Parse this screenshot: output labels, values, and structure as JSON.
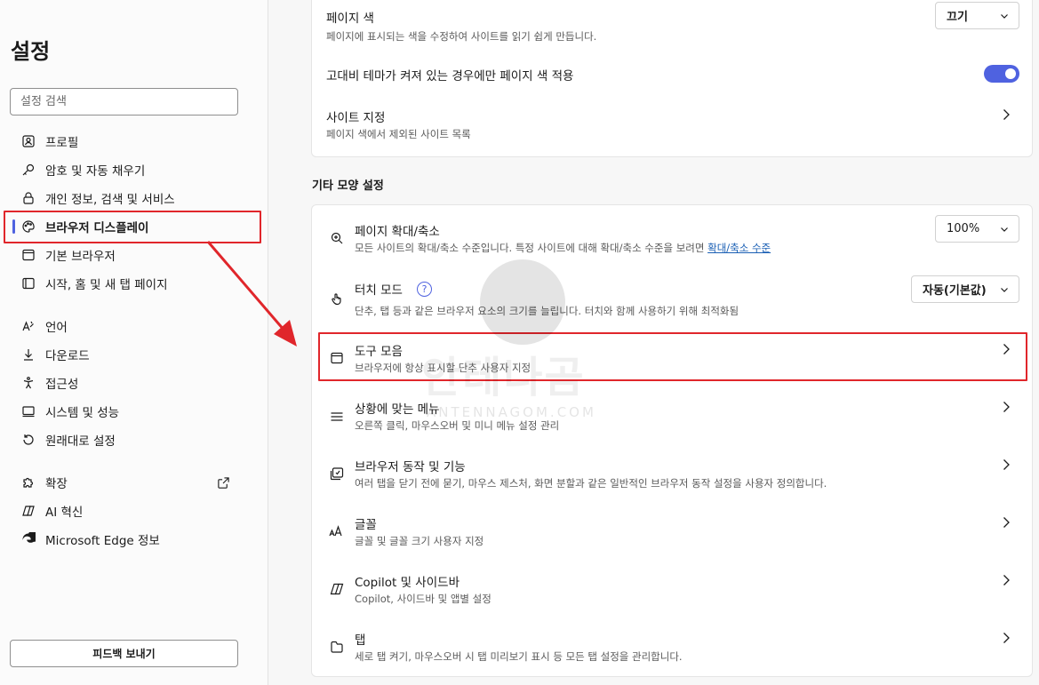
{
  "sidebar": {
    "title": "설정",
    "search_placeholder": "설정 검색",
    "items": [
      {
        "label": "프로필",
        "icon": "profile-icon"
      },
      {
        "label": "암호 및 자동 채우기",
        "icon": "key-icon"
      },
      {
        "label": "개인 정보, 검색 및 서비스",
        "icon": "lock-icon"
      },
      {
        "label": "브라우저 디스플레이",
        "icon": "palette-icon",
        "active": true
      },
      {
        "label": "기본 브라우저",
        "icon": "browser-icon"
      },
      {
        "label": "시작, 홈 및 새 탭 페이지",
        "icon": "home-icon"
      },
      {
        "label": "언어",
        "icon": "language-icon"
      },
      {
        "label": "다운로드",
        "icon": "download-icon"
      },
      {
        "label": "접근성",
        "icon": "accessibility-icon"
      },
      {
        "label": "시스템 및 성능",
        "icon": "system-icon"
      },
      {
        "label": "원래대로 설정",
        "icon": "reset-icon"
      },
      {
        "label": "확장",
        "icon": "extension-icon"
      },
      {
        "label": "AI 혁신",
        "icon": "ai-icon"
      },
      {
        "label": "Microsoft Edge 정보",
        "icon": "edge-icon"
      }
    ],
    "feedback_label": "피드백 보내기"
  },
  "top_card": {
    "page_color": {
      "title": "페이지 색",
      "desc": "페이지에 표시되는 색을 수정하여 사이트를 읽기 쉽게 만듭니다.",
      "value": "끄기"
    },
    "high_contrast": {
      "title": "고대비 테마가 켜져 있는 경우에만 페이지 색 적용",
      "enabled": true
    },
    "site_exclusions": {
      "title": "사이트 지정",
      "desc": "페이지 색에서 제외된 사이트 목록"
    }
  },
  "section_title": "기타 모양 설정",
  "other_card": {
    "zoom": {
      "title": "페이지 확대/축소",
      "desc": "모든 사이트의 확대/축소 수준입니다. 특정 사이트에 대해 확대/축소 수준을 보려면 ",
      "link": "확대/축소 수준",
      "value": "100%"
    },
    "touch": {
      "title": "터치 모드",
      "desc": "단추, 탭 등과 같은 브라우저 요소의 크기를 늘립니다. 터치와 함께 사용하기 위해 최적화됨",
      "value": "자동(기본값)",
      "help": "?"
    },
    "toolbar": {
      "title": "도구 모음",
      "desc": "브라우저에 항상 표시할 단추 사용자 지정"
    },
    "context_menu": {
      "title": "상황에 맞는 메뉴",
      "desc": "오른쪽 클릭, 마우스오버 및 미니 메뉴 설정 관리"
    },
    "behavior": {
      "title": "브라우저 동작 및 기능",
      "desc": "여러 탭을 닫기 전에 묻기, 마우스 제스처, 화면 분할과 같은 일반적인 브라우저 동작 설정을 사용자 정의합니다."
    },
    "fonts": {
      "title": "글꼴",
      "desc": "글꼴 및 글꼴 크기 사용자 지정"
    },
    "copilot": {
      "title": "Copilot 및 사이드바",
      "desc": "Copilot, 사이드바 및 앱별 설정"
    },
    "tabs": {
      "title": "탭",
      "desc": "세로 탭 켜기, 마우스오버 시 탭 미리보기 표시 등 모든 탭 설정을 관리합니다."
    }
  },
  "watermark": {
    "text": "안테나곰",
    "sub": "ANTENNAGOM.COM"
  },
  "colors": {
    "accent": "#4f62e0",
    "highlight": "#e0262b"
  }
}
